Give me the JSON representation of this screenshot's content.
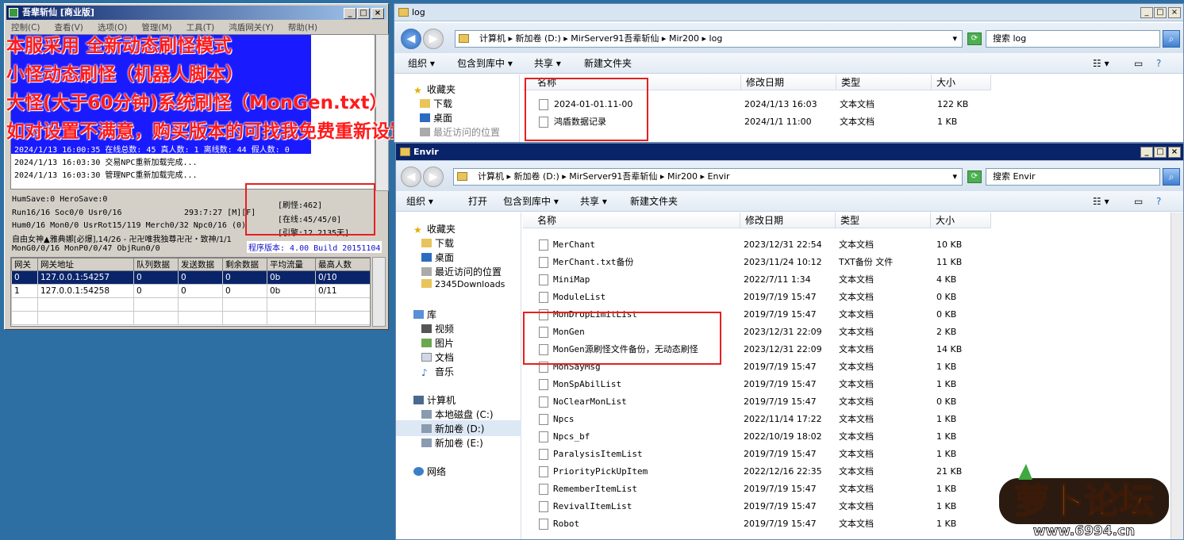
{
  "server": {
    "title": "吾辈斩仙 [商业版]",
    "menu": [
      "控制(C)",
      "查看(V)",
      "选项(O)",
      "管理(M)",
      "工具(T)",
      "鸿盾网关(Y)",
      "帮助(H)"
    ],
    "log": [
      "2024/1/13 16:00:35 在线总数: 45 真人数: 1 离线数: 44 假人数: 0",
      "2024/1/13 16:03:30 交易NPC重新加载完成...",
      "2024/1/13 16:03:30 管理NPC重新加载完成..."
    ],
    "stats": [
      "HumSave:0 HeroSave:0",
      "Run16/16 Soc0/0 Usr0/16",
      "Hum0/16 Mon0/0 UsrRot15/119 Merch0/32 Npc0/16 (0)",
      "自由女神▲雅典娜[必爆],14/26 - 卍卍唯我独尊卍卍・致神/1/1",
      "MonG0/0/16 MonP0/0/47 ObjRun0/0"
    ],
    "clock": "293:7:27 [M][F]",
    "side_stats": [
      "[刷怪:462]",
      "[在线:45/45/0]",
      "[引擎:12.2135天]"
    ],
    "version": "程序版本: 4.00 Build 20151104",
    "grid": {
      "headers": [
        "网关",
        "网关地址",
        "队列数据",
        "发送数据",
        "剩余数据",
        "平均流量",
        "最高人数"
      ],
      "rows": [
        [
          "0",
          "127.0.0.1:54257",
          "0",
          "0",
          "0",
          "0b",
          "0/10"
        ],
        [
          "1",
          "127.0.0.1:54258",
          "0",
          "0",
          "0",
          "0b",
          "0/11"
        ]
      ]
    }
  },
  "overlay": [
    "本服采用 全新动态刷怪模式",
    "小怪动态刷怪（机器人脚本）",
    "大怪(大于60分钟)系统刷怪（MonGen.txt）",
    "如对设置不满意，购买版本的可找我免费重新设置一次"
  ],
  "log_window": {
    "title": "log",
    "path": [
      "计算机",
      "新加卷 (D:)",
      "MirServer91吾辈斩仙",
      "Mir200",
      "log"
    ],
    "search": "搜索 log",
    "toolbar": [
      "组织 ▾",
      "包含到库中 ▾",
      "共享 ▾",
      "新建文件夹"
    ],
    "nav": [
      "收藏夹",
      "下载",
      "桌面",
      "最近访问的位置"
    ],
    "columns": [
      "名称",
      "修改日期",
      "类型",
      "大小"
    ],
    "files": [
      {
        "name": "2024-01-01.11-00",
        "date": "2024/1/13 16:03",
        "type": "文本文档",
        "size": "122 KB"
      },
      {
        "name": "鸿盾数据记录",
        "date": "2024/1/1 11:00",
        "type": "文本文档",
        "size": "1 KB"
      }
    ]
  },
  "envir_window": {
    "title": "Envir",
    "path": [
      "计算机",
      "新加卷 (D:)",
      "MirServer91吾辈斩仙",
      "Mir200",
      "Envir"
    ],
    "search": "搜索 Envir",
    "toolbar": [
      "组织 ▾",
      "打开",
      "包含到库中 ▾",
      "共享 ▾",
      "新建文件夹"
    ],
    "nav": [
      "收藏夹",
      "下载",
      "桌面",
      "最近访问的位置",
      "2345Downloads",
      "库",
      "视频",
      "图片",
      "文档",
      "音乐",
      "计算机",
      "本地磁盘 (C:)",
      "新加卷 (D:)",
      "新加卷 (E:)",
      "网络"
    ],
    "columns": [
      "名称",
      "修改日期",
      "类型",
      "大小"
    ],
    "files": [
      {
        "name": "MerChant",
        "date": "2023/12/31 22:54",
        "type": "文本文档",
        "size": "10 KB"
      },
      {
        "name": "MerChant.txt备份",
        "date": "2023/11/24 10:12",
        "type": "TXT备份 文件",
        "size": "11 KB"
      },
      {
        "name": "MiniMap",
        "date": "2022/7/11 1:34",
        "type": "文本文档",
        "size": "4 KB"
      },
      {
        "name": "ModuleList",
        "date": "2019/7/19 15:47",
        "type": "文本文档",
        "size": "0 KB"
      },
      {
        "name": "MonDropLimitList",
        "date": "2019/7/19 15:47",
        "type": "文本文档",
        "size": "0 KB"
      },
      {
        "name": "MonGen",
        "date": "2023/12/31 22:09",
        "type": "文本文档",
        "size": "2 KB"
      },
      {
        "name": "MonGen源刷怪文件备份，无动态刷怪",
        "date": "2023/12/31 22:09",
        "type": "文本文档",
        "size": "14 KB"
      },
      {
        "name": "MonSayMsg",
        "date": "2019/7/19 15:47",
        "type": "文本文档",
        "size": "1 KB"
      },
      {
        "name": "MonSpAbilList",
        "date": "2019/7/19 15:47",
        "type": "文本文档",
        "size": "1 KB"
      },
      {
        "name": "NoClearMonList",
        "date": "2019/7/19 15:47",
        "type": "文本文档",
        "size": "0 KB"
      },
      {
        "name": "Npcs",
        "date": "2022/11/14 17:22",
        "type": "文本文档",
        "size": "1 KB"
      },
      {
        "name": "Npcs_bf",
        "date": "2022/10/19 18:02",
        "type": "文本文档",
        "size": "1 KB"
      },
      {
        "name": "ParalysisItemList",
        "date": "2019/7/19 15:47",
        "type": "文本文档",
        "size": "1 KB"
      },
      {
        "name": "PriorityPickUpItem",
        "date": "2022/12/16 22:35",
        "type": "文本文档",
        "size": "21 KB"
      },
      {
        "name": "RememberItemList",
        "date": "2019/7/19 15:47",
        "type": "文本文档",
        "size": "1 KB"
      },
      {
        "name": "RevivalItemList",
        "date": "2019/7/19 15:47",
        "type": "文本文档",
        "size": "1 KB"
      },
      {
        "name": "Robot",
        "date": "2019/7/19 15:47",
        "type": "文本文档",
        "size": "1 KB"
      }
    ]
  },
  "logo": {
    "brand": "萝卜论坛",
    "url": "www.6994.cn"
  },
  "colors": {
    "overlay": "#ff1a1a",
    "highlight_box": "#e62020",
    "selected_row": "#0a246a"
  }
}
